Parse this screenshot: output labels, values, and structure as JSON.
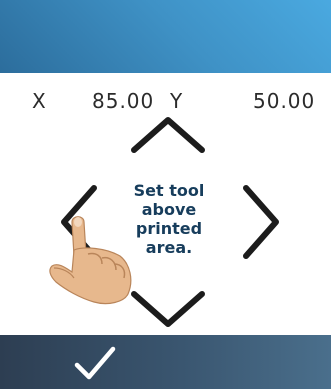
{
  "header": {
    "color": "#3f92c6"
  },
  "coordinates": {
    "x_label": "X",
    "x_value": "85.00",
    "y_label": "Y",
    "y_value": "50.00"
  },
  "jog_pad": {
    "instruction_lines": [
      "Set tool",
      "above",
      "printed",
      "area."
    ],
    "icons": [
      "chevron-up-icon",
      "chevron-down-icon",
      "chevron-left-icon",
      "chevron-right-icon",
      "hand-pointer-icon"
    ]
  },
  "footer": {
    "confirm_icon": "checkmark-icon",
    "color": "#2d3e52"
  }
}
